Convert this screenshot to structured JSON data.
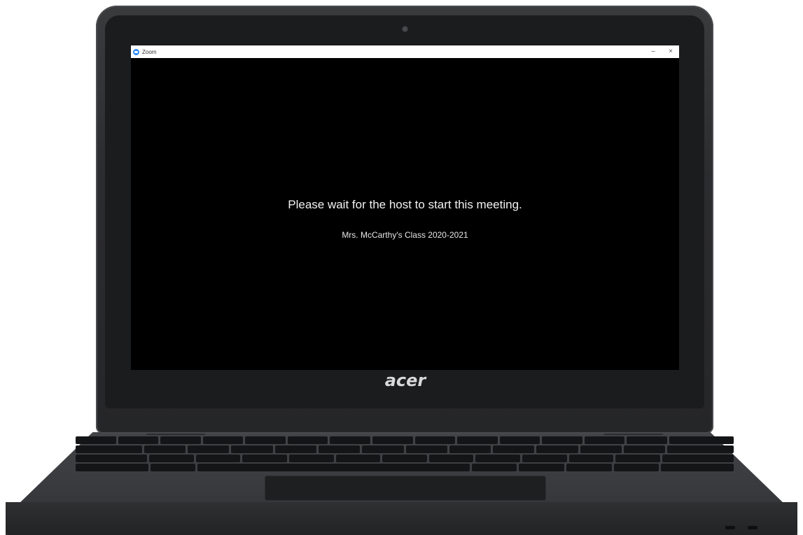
{
  "device": {
    "brand_logo": "acer"
  },
  "window": {
    "app_title": "Zoom",
    "minimize_glyph": "–",
    "close_glyph": "×",
    "app_icon": "zoom-icon"
  },
  "meeting": {
    "status_message": "Please wait for the host to start this meeting.",
    "meeting_name": "Mrs. McCarthy's Class 2020-2021"
  },
  "colors": {
    "screen_background": "#000000",
    "zoom_blue": "#2d8cff",
    "text": "#f2f2f2"
  }
}
